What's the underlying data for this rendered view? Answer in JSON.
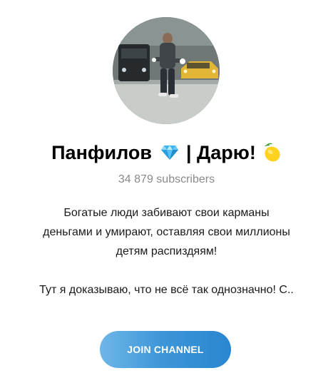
{
  "channel": {
    "name_part1": "Панфилов",
    "name_part2": "| Дарю!",
    "emoji_1": "gem-stone-icon",
    "emoji_2": "lemon-icon",
    "subscribers": "34 879 subscribers",
    "description_lines": [
      "Богатые люди забивают свои карманы",
      "деньгами и умирают, оставляя свои миллионы",
      "детям распиздяям!",
      "Тут я доказываю, что не всё так однозначно! С.."
    ]
  },
  "actions": {
    "join_label": "JOIN CHANNEL"
  },
  "colors": {
    "button_gradient_start": "#6fb6e8",
    "button_gradient_end": "#2a86cf",
    "subscribers_text": "#8a8a8a"
  }
}
